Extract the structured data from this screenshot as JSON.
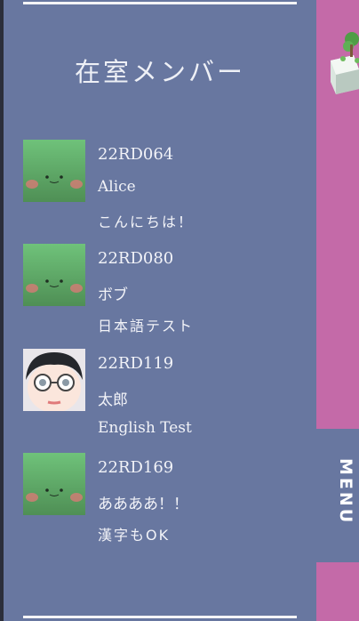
{
  "panel": {
    "title": "在室メンバー"
  },
  "members": [
    {
      "id": "22RD064",
      "name": "Alice",
      "message": "こんにちは！",
      "avatar": "green-face-avatar"
    },
    {
      "id": "22RD080",
      "name": "ボブ",
      "message": "日本語テスト",
      "avatar": "green-face-avatar"
    },
    {
      "id": "22RD119",
      "name": "太郎",
      "message": "English Test",
      "avatar": "glasses-boy-avatar"
    },
    {
      "id": "22RD169",
      "name": "ああああ！！",
      "message": "漢字もOK",
      "avatar": "green-face-avatar"
    }
  ],
  "menu": {
    "label": "MENU"
  },
  "colors": {
    "panel": "#6877a0",
    "background": "#c46aa8",
    "text": "#f2f3f8"
  }
}
